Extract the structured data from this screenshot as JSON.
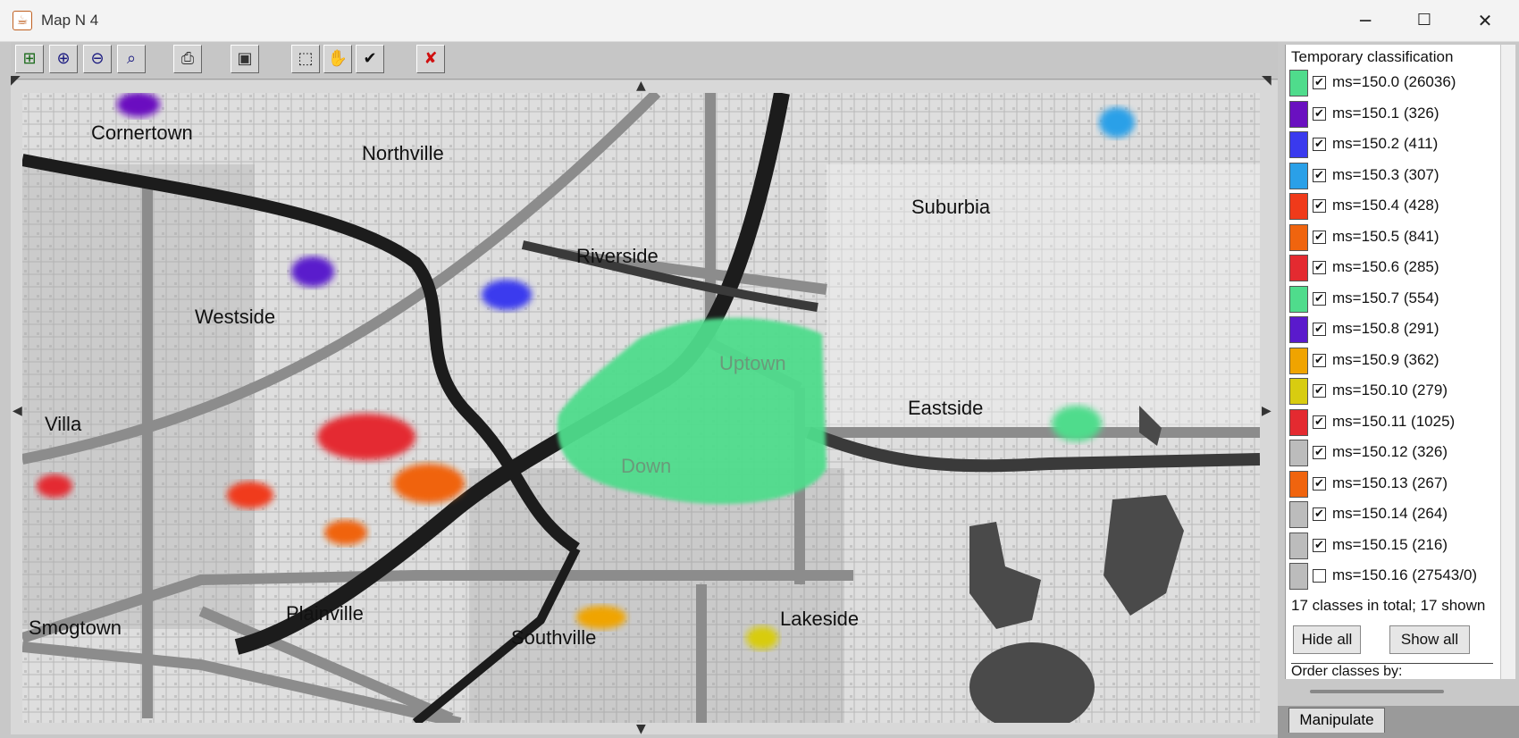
{
  "window": {
    "title": "Map N 4",
    "minimize": "─",
    "maximize": "☐",
    "close": "✕"
  },
  "toolbar": [
    {
      "name": "fit-map-button",
      "glyph": "⊞"
    },
    {
      "name": "zoom-in-button",
      "glyph": "⊕"
    },
    {
      "name": "zoom-out-button",
      "glyph": "⊖"
    },
    {
      "name": "find-location-button",
      "glyph": "⌕"
    },
    {
      "name": "print-button",
      "glyph": "⎙"
    },
    {
      "name": "save-button",
      "glyph": "▣"
    },
    {
      "name": "select-rectangle-button",
      "glyph": "⬚"
    },
    {
      "name": "pan-hand-button",
      "glyph": "✋"
    },
    {
      "name": "confirm-button",
      "glyph": "✔"
    },
    {
      "name": "cancel-tool-button",
      "glyph": "✘"
    }
  ],
  "places": [
    "Cornertown",
    "Northville",
    "Riverside",
    "Suburbia",
    "Westside",
    "Uptown",
    "Eastside",
    "Villa",
    "Down",
    "Plainville",
    "Smogtown",
    "Southville",
    "Lakeside"
  ],
  "panel": {
    "title": "Temporary classification",
    "classes": [
      {
        "label": "ms=150.0 (26036)",
        "color": "#4fdc8c",
        "checked": true
      },
      {
        "label": "ms=150.1 (326)",
        "color": "#6a10c0",
        "checked": true
      },
      {
        "label": "ms=150.2 (411)",
        "color": "#3a3aee",
        "checked": true
      },
      {
        "label": "ms=150.3 (307)",
        "color": "#2aa0e8",
        "checked": true
      },
      {
        "label": "ms=150.4 (428)",
        "color": "#f03a1a",
        "checked": true
      },
      {
        "label": "ms=150.5 (841)",
        "color": "#f0640e",
        "checked": true
      },
      {
        "label": "ms=150.6 (285)",
        "color": "#e42a30",
        "checked": true
      },
      {
        "label": "ms=150.7 (554)",
        "color": "#4fdc8c",
        "checked": true
      },
      {
        "label": "ms=150.8 (291)",
        "color": "#5a1acc",
        "checked": true
      },
      {
        "label": "ms=150.9 (362)",
        "color": "#f0a400",
        "checked": true
      },
      {
        "label": "ms=150.10 (279)",
        "color": "#d8cc10",
        "checked": true
      },
      {
        "label": "ms=150.11 (1025)",
        "color": "#e42a30",
        "checked": true
      },
      {
        "label": "ms=150.12 (326)",
        "color": "#bcbcbc",
        "checked": true
      },
      {
        "label": "ms=150.13 (267)",
        "color": "#f0640e",
        "checked": true
      },
      {
        "label": "ms=150.14 (264)",
        "color": "#bcbcbc",
        "checked": true
      },
      {
        "label": "ms=150.15 (216)",
        "color": "#bcbcbc",
        "checked": true
      },
      {
        "label": "ms=150.16 (27543/0)",
        "color": "#bcbcbc",
        "checked": false
      }
    ],
    "total": "17 classes in total; 17 shown",
    "hide_all": "Hide all",
    "show_all": "Show all",
    "order_label": "Order classes by:",
    "tab": "Manipulate"
  }
}
